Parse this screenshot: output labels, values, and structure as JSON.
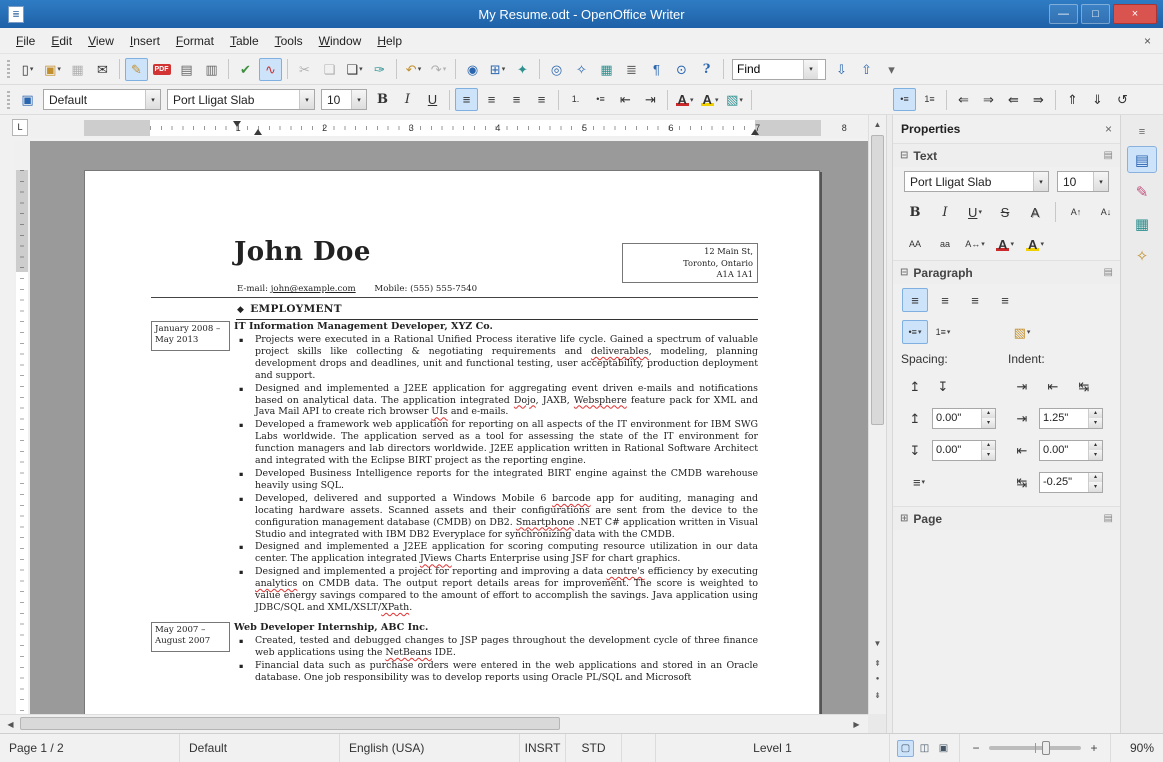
{
  "window": {
    "title": "My Resume.odt - OpenOffice Writer",
    "icon_glyph": "≣",
    "minimize_glyph": "—",
    "maximize_glyph": "□",
    "close_glyph": "×"
  },
  "menubar": {
    "items": [
      {
        "id": "menu-file",
        "label": "File"
      },
      {
        "id": "menu-edit",
        "label": "Edit"
      },
      {
        "id": "menu-view",
        "label": "View"
      },
      {
        "id": "menu-insert",
        "label": "Insert"
      },
      {
        "id": "menu-format",
        "label": "Format"
      },
      {
        "id": "menu-table",
        "label": "Table"
      },
      {
        "id": "menu-tools",
        "label": "Tools"
      },
      {
        "id": "menu-window",
        "label": "Window"
      },
      {
        "id": "menu-help",
        "label": "Help"
      }
    ],
    "close_glyph": "×"
  },
  "toolbar_main": {
    "items": [
      {
        "name": "new-document-icon",
        "glyph": "▯",
        "dd": "▾"
      },
      {
        "name": "open-icon",
        "glyph": "▣",
        "gcls": "g c-amber",
        "dd": "▾"
      },
      {
        "name": "save-icon",
        "glyph": "▦",
        "btncls": "tbtn disabled"
      },
      {
        "name": "email-document-icon",
        "glyph": "✉"
      },
      {
        "name": "toolbar-separator",
        "btncls": "tsep",
        "inter": "false"
      },
      {
        "name": "edit-file-icon",
        "glyph": "✎",
        "btncls": "tbtn active",
        "gcls": "g c-amber"
      },
      {
        "name": "export-pdf-icon",
        "glyph": "PDF",
        "gcls": "g pdfb"
      },
      {
        "name": "print-icon",
        "glyph": "▤",
        "gcls": "g c-gray"
      },
      {
        "name": "page-preview-icon",
        "glyph": "▥",
        "gcls": "g c-gray"
      },
      {
        "name": "toolbar-separator",
        "btncls": "tsep",
        "inter": "false"
      },
      {
        "name": "spelling-icon",
        "glyph": "✔",
        "gcls": "g c-green"
      },
      {
        "name": "autospellcheck-icon",
        "glyph": "∿",
        "btncls": "tbtn active",
        "gcls": "g c-red"
      },
      {
        "name": "toolbar-separator",
        "btncls": "tsep",
        "inter": "false"
      },
      {
        "name": "cut-icon",
        "glyph": "✂",
        "btncls": "tbtn disabled"
      },
      {
        "name": "copy-icon",
        "glyph": "❏",
        "btncls": "tbtn disabled"
      },
      {
        "name": "paste-icon",
        "glyph": "❑",
        "dd": "▾"
      },
      {
        "name": "format-paintbrush-icon",
        "glyph": "✑",
        "gcls": "g c-teal"
      },
      {
        "name": "toolbar-separator",
        "btncls": "tsep",
        "inter": "false"
      },
      {
        "name": "undo-icon",
        "glyph": "↶",
        "gcls": "g c-amber",
        "dd": "▾"
      },
      {
        "name": "redo-icon",
        "glyph": "↷",
        "btncls": "tbtn disabled",
        "dd": "▾"
      },
      {
        "name": "toolbar-separator",
        "btncls": "tsep",
        "inter": "false"
      },
      {
        "name": "hyperlink-icon",
        "glyph": "◉",
        "gcls": "g c-blue"
      },
      {
        "name": "table-icon",
        "glyph": "⊞",
        "gcls": "g c-blue",
        "dd": "▾"
      },
      {
        "name": "draw-functions-icon",
        "glyph": "✦",
        "gcls": "g c-teal"
      },
      {
        "name": "toolbar-separator",
        "btncls": "tsep",
        "inter": "false"
      },
      {
        "name": "find-replace-icon",
        "glyph": "◎",
        "gcls": "g c-blue"
      },
      {
        "name": "navigator-icon",
        "glyph": "✧",
        "gcls": "g c-blue"
      },
      {
        "name": "gallery-icon",
        "glyph": "▦",
        "gcls": "g c-teal"
      },
      {
        "name": "data-sources-icon",
        "glyph": "≣",
        "gcls": "g c-gray"
      },
      {
        "name": "nonprinting-characters-icon",
        "glyph": "¶",
        "gcls": "g c-blue"
      },
      {
        "name": "zoom-icon",
        "glyph": "⊙",
        "gcls": "g c-blue"
      },
      {
        "name": "help-icon",
        "glyph": "?",
        "gcls": "g c-blue bld"
      },
      {
        "name": "toolbar-separator",
        "btncls": "tsep",
        "inter": "false"
      }
    ],
    "find": {
      "value": "Find",
      "arrow": "▾"
    },
    "after_find": [
      {
        "name": "find-next-icon",
        "glyph": "⇩",
        "gcls": "g c-blue"
      },
      {
        "name": "find-previous-icon",
        "glyph": "⇧",
        "gcls": "g c-blue"
      },
      {
        "name": "toolbar-options-icon",
        "glyph": "▾",
        "gcls": "g c-gray"
      }
    ]
  },
  "toolbar_format": {
    "pre_glyph": "▣",
    "style": "Default",
    "font": "Port Lligat Slab",
    "size": "10",
    "arrow": "▾",
    "items": [
      {
        "name": "bold-icon",
        "glyph": "B",
        "gcls": "g bld"
      },
      {
        "name": "italic-icon",
        "glyph": "I",
        "gcls": "g ita"
      },
      {
        "name": "underline-icon",
        "glyph": "U",
        "gcls": "g und"
      },
      {
        "name": "toolbar-separator",
        "btncls": "tsep",
        "inter": "false"
      },
      {
        "name": "align-left-icon",
        "glyph": "≡",
        "btncls": "tbtn active"
      },
      {
        "name": "align-center-icon",
        "glyph": "≡"
      },
      {
        "name": "align-right-icon",
        "glyph": "≡"
      },
      {
        "name": "align-justify-icon",
        "glyph": "≡"
      },
      {
        "name": "toolbar-separator",
        "btncls": "tsep",
        "inter": "false"
      },
      {
        "name": "numbering-list-icon",
        "glyph": "1.",
        "gcls": "g sm"
      },
      {
        "name": "bullets-list-icon",
        "glyph": "•≡",
        "gcls": "g sm"
      },
      {
        "name": "decrease-indent-icon",
        "glyph": "⇤"
      },
      {
        "name": "increase-indent-icon",
        "glyph": "⇥"
      },
      {
        "name": "toolbar-separator",
        "btncls": "tsep",
        "inter": "false"
      },
      {
        "name": "font-color-icon",
        "glyph": "A",
        "gcls": "g fc",
        "dd": "▾"
      },
      {
        "name": "highlighting-icon",
        "glyph": "A",
        "gcls": "g hl",
        "dd": "▾"
      },
      {
        "name": "background-color-icon",
        "glyph": "▧",
        "gcls": "g c-teal",
        "dd": "▾"
      },
      {
        "name": "toolbar-separator",
        "btncls": "tsep",
        "inter": "false"
      }
    ],
    "list_items": [
      {
        "name": "bullets-toggle-icon",
        "glyph": "•≡",
        "gcls": "g sm",
        "btncls": "tbtn active"
      },
      {
        "name": "numbering-toggle-icon",
        "glyph": "1≡",
        "gcls": "g sm"
      },
      {
        "name": "toolbar-separator",
        "btncls": "tsep",
        "inter": "false"
      },
      {
        "name": "promote-level-icon",
        "glyph": "⇐"
      },
      {
        "name": "demote-level-icon",
        "glyph": "⇒"
      },
      {
        "name": "promote-with-subpoints-icon",
        "glyph": "⇚"
      },
      {
        "name": "demote-with-subpoints-icon",
        "glyph": "⇛"
      },
      {
        "name": "toolbar-separator",
        "btncls": "tsep",
        "inter": "false"
      },
      {
        "name": "move-up-icon",
        "glyph": "⇑"
      },
      {
        "name": "move-down-icon",
        "glyph": "⇓"
      },
      {
        "name": "restart-numbering-icon",
        "glyph": "↺"
      }
    ]
  },
  "ruler": {
    "numbers": [
      "1",
      "2",
      "3",
      "4",
      "5",
      "6",
      "7",
      "8"
    ],
    "tab_selector_glyph": "L"
  },
  "scrollbars": {
    "up": "▲",
    "down": "▼",
    "left": "◀",
    "right": "▶",
    "prev_page": "⇞",
    "navigation": "●",
    "next_page": "⇟"
  },
  "document": {
    "name": "John Doe",
    "address_lines": [
      "12 Main St,",
      "Toronto, Ontario",
      "A1A 1A1"
    ],
    "email_label": "E-mail:",
    "email": "john@example.com",
    "mobile": "Mobile: (555) 555-7540",
    "section_bullet": "◆",
    "section_heading": "EMPLOYMENT",
    "jobs": [
      {
        "date": [
          "January 2008 –",
          "May 2013"
        ],
        "title": "IT Information Management Developer, XYZ Co.",
        "bullets": [
          "Projects were executed in a Rational Unified Process iterative life cycle. Gained a spectrum of valuable project skills like collecting & negotiating requirements and deliverables, modeling, planning development drops and deadlines, unit and functional testing, user acceptability, production deployment and support.",
          "Designed and implemented a J2EE application for aggregating event driven e-mails and notifications based on analytical data. The application integrated Dojo, JAXB, Websphere feature pack for XML and Java Mail API to create rich browser UIs and e-mails.",
          "Developed a framework web application for reporting on all aspects of the IT environment for IBM SWG Labs worldwide. The application served as a tool for assessing the state of the IT environment for function managers and lab directors worldwide. J2EE application written in Rational Software Architect and integrated with the Eclipse BIRT project as the reporting engine.",
          "Developed Business Intelligence reports for the integrated BIRT engine against the CMDB warehouse heavily using SQL.",
          "Developed, delivered and supported a Windows Mobile 6 barcode app for auditing, managing and locating hardware assets. Scanned assets and their configurations are sent from the device to the configuration management database (CMDB) on DB2. Smartphone .NET C# application written in Visual Studio and integrated with IBM DB2 Everyplace for synchronizing data with the CMDB.",
          "Designed and implemented a J2EE application for scoring computing resource utilization in our data center. The application integrated JViews Charts Enterprise using JSF for chart graphics.",
          "Designed and implemented a project for reporting and improving a data centre's efficiency by executing analytics on CMDB data. The output report details areas for improvement. The score is weighted to value energy savings compared to the amount of effort to accomplish the savings. Java application using JDBC/SQL and XML/XSLT/XPath."
        ]
      },
      {
        "date": [
          "May 2007 –",
          "August 2007"
        ],
        "title": "Web Developer Internship, ABC Inc.",
        "bullets": [
          "Created, tested and debugged changes to JSP pages throughout the development cycle of three finance web applications using the NetBeans IDE.",
          "Financial data such as purchase orders were entered in the web applications and stored in an Oracle database. One job responsibility was to develop reports using Oracle PL/SQL and Microsoft"
        ]
      }
    ],
    "misspelled": [
      "deliverables",
      "Dojo",
      "Websphere",
      "UIs",
      "barcode",
      "Smartphone",
      "JViews",
      "centre's",
      "analytics",
      "XPath",
      "NetBeans"
    ]
  },
  "sidebar": {
    "title": "Properties",
    "close_glyph": "×",
    "expander_glyph": "⊟",
    "collapsed_glyph": "⊞",
    "more_glyph": "▤",
    "spin_up": "▴",
    "spin_down": "▾",
    "sections": {
      "text": "Text",
      "paragraph": "Paragraph",
      "page": "Page"
    },
    "text": {
      "font": "Port Lligat Slab",
      "size": "10",
      "row1": [
        {
          "name": "sidebar-bold-icon",
          "glyph": "B",
          "gcls": "g bld"
        },
        {
          "name": "sidebar-italic-icon",
          "glyph": "I",
          "gcls": "g ita"
        },
        {
          "name": "sidebar-underline-icon",
          "glyph": "U",
          "gcls": "g und",
          "dd": "▾"
        },
        {
          "name": "strikethrough-icon",
          "glyph": "S",
          "gcls": "g str"
        },
        {
          "name": "text-shadow-icon",
          "glyph": "A",
          "gcls": "g shd"
        },
        {
          "name": "toolbar-separator",
          "btncls": "tsep",
          "inter": "false"
        },
        {
          "name": "grow-font-icon",
          "glyph": "A↑",
          "gcls": "g sm"
        },
        {
          "name": "shrink-font-icon",
          "glyph": "A↓",
          "gcls": "g sm"
        }
      ],
      "row2": [
        {
          "name": "uppercase-icon",
          "glyph": "AA",
          "gcls": "g sm"
        },
        {
          "name": "lowercase-icon",
          "glyph": "aa",
          "gcls": "g sm"
        },
        {
          "name": "character-spacing-icon",
          "glyph": "A↔",
          "gcls": "g sm",
          "dd": "▾"
        },
        {
          "name": "sidebar-font-color-icon",
          "glyph": "A",
          "gcls": "g fc",
          "dd": "▾"
        },
        {
          "name": "sidebar-highlighting-icon",
          "glyph": "A",
          "gcls": "g hl",
          "dd": "▾"
        }
      ]
    },
    "paragraph": {
      "align_row": [
        {
          "name": "sidebar-align-left-icon",
          "glyph": "≡",
          "btncls": "tbtn active"
        },
        {
          "name": "sidebar-align-center-icon",
          "glyph": "≡"
        },
        {
          "name": "sidebar-align-right-icon",
          "glyph": "≡"
        },
        {
          "name": "sidebar-align-justify-icon",
          "glyph": "≡"
        }
      ],
      "lists_row": [
        {
          "name": "sidebar-bullets-icon",
          "glyph": "•≡",
          "gcls": "g sm",
          "btncls": "tbtn active",
          "dd": "▾"
        },
        {
          "name": "sidebar-numbering-icon",
          "glyph": "1≡",
          "gcls": "g sm",
          "dd": "▾"
        }
      ],
      "bg_row": [
        {
          "name": "sidebar-background-color-icon",
          "glyph": "▧",
          "gcls": "g c-amber",
          "dd": "▾"
        }
      ],
      "spacing_label": "Spacing:",
      "indent_label": "Indent:",
      "spacing_icons": [
        {
          "name": "increase-spacing-icon",
          "glyph": "↥"
        },
        {
          "name": "decrease-spacing-icon",
          "glyph": "↧"
        }
      ],
      "indent_icons": [
        {
          "name": "sidebar-increase-indent-icon",
          "glyph": "⇥"
        },
        {
          "name": "sidebar-decrease-indent-icon",
          "glyph": "⇤"
        },
        {
          "name": "switch-indent-icon",
          "glyph": "↹"
        }
      ],
      "field_icons": {
        "above": "↥",
        "below": "↧",
        "before": "⇥",
        "after": "⇤",
        "first": "↹"
      },
      "fields": {
        "above": "0.00\"",
        "below": "0.00\"",
        "before": "1.25\"",
        "after": "0.00\"",
        "first": "-0.25\""
      },
      "line_spacing_glyph": "≡"
    }
  },
  "sidetabs": {
    "menu_glyph": "≡",
    "items": [
      {
        "name": "sidebar-properties-tab",
        "glyph": "▤",
        "gcls": "g c-blue",
        "btncls": "stab active"
      },
      {
        "name": "sidebar-styles-tab",
        "glyph": "✎",
        "gcls": "g c-pink"
      },
      {
        "name": "sidebar-gallery-tab",
        "glyph": "▦",
        "gcls": "g c-teal"
      },
      {
        "name": "sidebar-navigator-tab",
        "glyph": "✧",
        "gcls": "g c-amber"
      }
    ]
  },
  "statusbar": {
    "page": "Page 1 / 2",
    "page_style": "Default",
    "language": "English (USA)",
    "insert_mode": "INSRT",
    "selection_mode": "STD",
    "outline_level": "Level 1",
    "view_icons": [
      {
        "name": "single-page-view-icon",
        "glyph": "▢",
        "btncls": "vbtn active"
      },
      {
        "name": "multi-page-view-icon",
        "glyph": "◫",
        "btncls": "vbtn"
      },
      {
        "name": "book-view-icon",
        "glyph": "▣",
        "btncls": "vbtn"
      }
    ],
    "zoom_minus": "−",
    "zoom_plus": "+",
    "zoom_level": "90%"
  }
}
